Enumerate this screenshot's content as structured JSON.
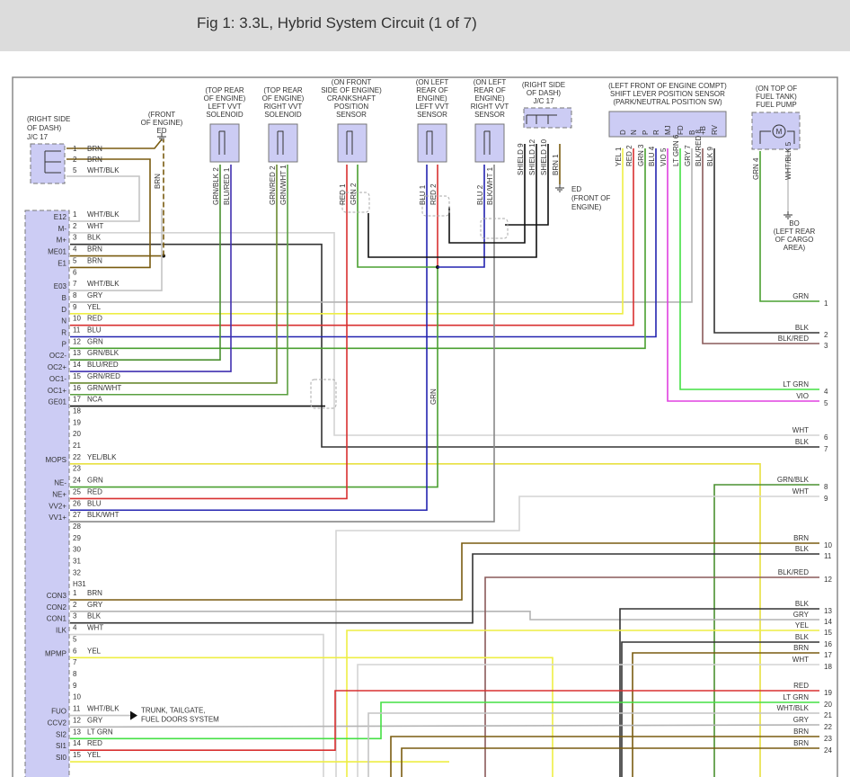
{
  "title": "Fig 1: 3.3L, Hybrid System Circuit (1 of 7)",
  "wire_colors": {
    "BRN": "#7a5c10",
    "WHT": "#d4d4d4",
    "BLK": "#333333",
    "GRY": "#b4b4b4",
    "YEL": "#eeee44",
    "RED": "#d83030",
    "BLU": "#2424b0",
    "GRN": "#4aa030",
    "LT GRN": "#44e044",
    "VIO": "#e040e0",
    "BLK/RED": "#8a5a5a",
    "GRN/BLK": "#4a9030",
    "GRN/RED": "#6a8a30",
    "GRN/WHT": "#5aa040",
    "BLU/RED": "#4030b0",
    "BLK/WHT": "#888888",
    "WHT/BLK": "#c4c4c4",
    "YEL/BLK": "#e8e040",
    "NCA": "#111111",
    "SHIELD": "#111111"
  },
  "components": {
    "jc17_left": {
      "lines": [
        "(RIGHT SIDE",
        "OF DASH)",
        "J/C 17"
      ],
      "pins": [
        {
          "num": "1",
          "wire": "BRN"
        },
        {
          "num": "2",
          "wire": "BRN"
        },
        {
          "num": "5",
          "wire": "WHT/BLK"
        }
      ]
    },
    "ground_ed_top": {
      "lines": [
        "(FRONT",
        "OF ENGINE)",
        "ED"
      ],
      "wire": "BRN"
    },
    "left_vvt_solenoid": {
      "lines": [
        "(TOP REAR",
        "OF ENGINE)",
        "LEFT VVT",
        "SOLENOID"
      ],
      "pins": [
        "GRN/BLK  2",
        "BLU/RED  1"
      ]
    },
    "right_vvt_solenoid": {
      "lines": [
        "(TOP REAR",
        "OF ENGINE)",
        "RIGHT VVT",
        "SOLENOID"
      ],
      "pins": [
        "GRN/RED  2",
        "GRN/WHT  1"
      ]
    },
    "crankshaft_sensor": {
      "lines": [
        "(ON FRONT",
        "SIDE OF ENGINE)",
        "CRANKSHAFT",
        "POSITION",
        "SENSOR"
      ],
      "pins": [
        "RED  1",
        "GRN  2"
      ]
    },
    "left_vvt_sensor": {
      "lines": [
        "(ON LEFT",
        "REAR OF",
        "ENGINE)",
        "LEFT VVT",
        "SENSOR"
      ],
      "pins": [
        "BLU  1",
        "RED  2"
      ]
    },
    "right_vvt_sensor": {
      "lines": [
        "(ON LEFT",
        "REAR OF",
        "ENGINE)",
        "RIGHT VVT",
        "SENSOR"
      ],
      "pins": [
        "BLU  2",
        "BLK/WHT  1"
      ]
    },
    "jc17_right": {
      "lines": [
        "(RIGHT SIDE",
        "OF DASH)",
        "J/C 17"
      ],
      "pins": [
        "SHIELD  9",
        "SHIELD  12",
        "SHIELD  10",
        "BRN  1"
      ]
    },
    "ground_ed_right": {
      "lines": [
        "ED",
        "(FRONT OF",
        "ENGINE)"
      ]
    },
    "shift_sensor": {
      "lines": [
        "(LEFT FRONT OF ENGINE COMPT)",
        "SHIFT LEVER POSITION SENSOR",
        "(PARK/NEUTRAL POSITION SW)"
      ],
      "terminals": [
        "D",
        "N",
        "P",
        "R",
        "MJ",
        "FD",
        "B",
        "+B",
        "RV"
      ],
      "pins": [
        "YEL  1",
        "RED  2",
        "GRN  3",
        "BLU  4",
        "VIO  5",
        "LT GRN  6",
        "GRY  7",
        "BLK/RED  8",
        "BLK  9"
      ]
    },
    "fuel_pump": {
      "lines": [
        "(ON TOP OF",
        "FUEL TANK)",
        "FUEL PUMP"
      ],
      "motor": "M",
      "pins": [
        "GRN  4",
        "WHT/BLK  5"
      ]
    },
    "ground_bo": {
      "lines": [
        "BO",
        "(LEFT REAR",
        "OF CARGO",
        "AREA)"
      ]
    }
  },
  "ecm_main": [
    {
      "fn": "E12",
      "num": "1",
      "wire": "WHT/BLK"
    },
    {
      "fn": "M-",
      "num": "2",
      "wire": "WHT"
    },
    {
      "fn": "M+",
      "num": "3",
      "wire": "BLK"
    },
    {
      "fn": "ME01",
      "num": "4",
      "wire": "BRN"
    },
    {
      "fn": "E1",
      "num": "5",
      "wire": "BRN"
    },
    {
      "fn": "",
      "num": "6",
      "wire": ""
    },
    {
      "fn": "E03",
      "num": "7",
      "wire": "WHT/BLK"
    },
    {
      "fn": "B",
      "num": "8",
      "wire": "GRY"
    },
    {
      "fn": "D",
      "num": "9",
      "wire": "YEL"
    },
    {
      "fn": "N",
      "num": "10",
      "wire": "RED"
    },
    {
      "fn": "R",
      "num": "11",
      "wire": "BLU"
    },
    {
      "fn": "P",
      "num": "12",
      "wire": "GRN"
    },
    {
      "fn": "OC2-",
      "num": "13",
      "wire": "GRN/BLK"
    },
    {
      "fn": "OC2+",
      "num": "14",
      "wire": "BLU/RED"
    },
    {
      "fn": "OC1-",
      "num": "15",
      "wire": "GRN/RED"
    },
    {
      "fn": "OC1+",
      "num": "16",
      "wire": "GRN/WHT"
    },
    {
      "fn": "GE01",
      "num": "17",
      "wire": "NCA"
    },
    {
      "fn": "",
      "num": "18",
      "wire": ""
    },
    {
      "fn": "",
      "num": "19",
      "wire": ""
    },
    {
      "fn": "",
      "num": "20",
      "wire": ""
    },
    {
      "fn": "",
      "num": "21",
      "wire": ""
    },
    {
      "fn": "MOPS",
      "num": "22",
      "wire": "YEL/BLK"
    },
    {
      "fn": "",
      "num": "23",
      "wire": ""
    },
    {
      "fn": "NE-",
      "num": "24",
      "wire": "GRN"
    },
    {
      "fn": "NE+",
      "num": "25",
      "wire": "RED"
    },
    {
      "fn": "VV2+",
      "num": "26",
      "wire": "BLU"
    },
    {
      "fn": "VV1+",
      "num": "27",
      "wire": "BLK/WHT"
    },
    {
      "fn": "",
      "num": "28",
      "wire": ""
    },
    {
      "fn": "",
      "num": "29",
      "wire": ""
    },
    {
      "fn": "",
      "num": "30",
      "wire": ""
    },
    {
      "fn": "",
      "num": "31",
      "wire": ""
    },
    {
      "fn": "",
      "num": "32",
      "wire": ""
    }
  ],
  "ecm_h31_label": "H31",
  "ecm_h31": [
    {
      "fn": "CON3",
      "num": "1",
      "wire": "BRN"
    },
    {
      "fn": "CON2",
      "num": "2",
      "wire": "GRY"
    },
    {
      "fn": "CON1",
      "num": "3",
      "wire": "BLK"
    },
    {
      "fn": "ILK",
      "num": "4",
      "wire": "WHT"
    },
    {
      "fn": "",
      "num": "5",
      "wire": ""
    },
    {
      "fn": "MPMP",
      "num": "6",
      "wire": "YEL"
    },
    {
      "fn": "",
      "num": "7",
      "wire": ""
    },
    {
      "fn": "",
      "num": "8",
      "wire": ""
    },
    {
      "fn": "",
      "num": "9",
      "wire": ""
    },
    {
      "fn": "",
      "num": "10",
      "wire": ""
    },
    {
      "fn": "FUO",
      "num": "11",
      "wire": "WHT/BLK"
    },
    {
      "fn": "CCV2",
      "num": "12",
      "wire": "GRY"
    },
    {
      "fn": "SI2",
      "num": "13",
      "wire": "LT GRN"
    },
    {
      "fn": "SI1",
      "num": "14",
      "wire": "RED"
    },
    {
      "fn": "SI0",
      "num": "15",
      "wire": "YEL"
    }
  ],
  "trunk_note": [
    "TRUNK, TAILGATE,",
    "FUEL DOORS SYSTEM"
  ],
  "vertical_labels": {
    "brn_ed": "BRN",
    "grn_mid": "GRN"
  },
  "right_outputs": [
    {
      "num": "1",
      "wire": "GRN"
    },
    {
      "num": "2",
      "wire": "BLK"
    },
    {
      "num": "3",
      "wire": "BLK/RED"
    },
    {
      "num": "4",
      "wire": "LT GRN"
    },
    {
      "num": "5",
      "wire": "VIO"
    },
    {
      "num": "6",
      "wire": "WHT"
    },
    {
      "num": "7",
      "wire": "BLK"
    },
    {
      "num": "8",
      "wire": "GRN/BLK"
    },
    {
      "num": "9",
      "wire": "WHT"
    },
    {
      "num": "10",
      "wire": "BRN"
    },
    {
      "num": "11",
      "wire": "BLK"
    },
    {
      "num": "12",
      "wire": "BLK/RED"
    },
    {
      "num": "13",
      "wire": "BLK"
    },
    {
      "num": "14",
      "wire": "GRY"
    },
    {
      "num": "15",
      "wire": "YEL"
    },
    {
      "num": "16",
      "wire": "BLK"
    },
    {
      "num": "17",
      "wire": "BRN"
    },
    {
      "num": "18",
      "wire": "WHT"
    },
    {
      "num": "19",
      "wire": "RED"
    },
    {
      "num": "20",
      "wire": "LT GRN"
    },
    {
      "num": "21",
      "wire": "WHT/BLK"
    },
    {
      "num": "22",
      "wire": "GRY"
    },
    {
      "num": "23",
      "wire": "BRN"
    },
    {
      "num": "24",
      "wire": "BRN"
    }
  ]
}
